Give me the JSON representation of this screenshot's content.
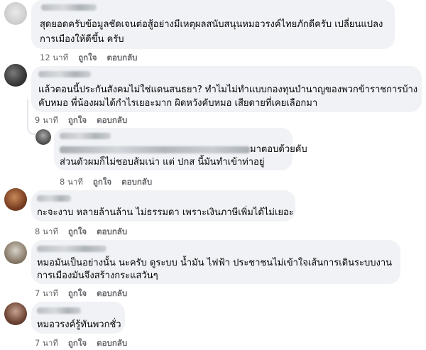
{
  "comments": [
    {
      "text_lines": [
        "สุดยอดครับข้อมูลชัดเจนต่อสู้อย่างมีเหตุผลสนับสนุนหมอวรงค์ไทยภักดีครับ เปลี่ยนแปลง",
        "การเมืองให้ดีขึ้น ครับ"
      ],
      "time": "12 นาที",
      "like": "ถูกใจ",
      "reply": "ตอบกลับ"
    },
    {
      "text_lines": [
        "แล้วตอนนี้ประกันสังคมไม่ใช่แดนสนธยา? ทำไมไม่ทำแบบกองทุนบำนาญของพวกข้าราชการบ้าง",
        "คับหมอ พี่น้องผมได้กำไรเยอะมาก ผิดหวังคับหมอ เสียดายที่เคยเลือกมา"
      ],
      "time": "9 นาที",
      "like": "ถูกใจ",
      "reply": "ตอบกลับ"
    },
    {
      "text_lines": [
        "มาตอบด้วยคับ",
        "ส่วนตัวผมก็ไม่ชอบส้มเน่า แต่ ปกส นี้มันทำเข้าท่าอยู่"
      ],
      "time": "8 นาที",
      "like": "ถูกใจ",
      "reply": "ตอบกลับ"
    },
    {
      "text_lines": [
        "กะจะงาบ หลายล้านล้าน ไม่ธรรมดา เพราะเงินภาษีเพิ่มได้ไม่เยอะ"
      ],
      "time": "8 นาที",
      "like": "ถูกใจ",
      "reply": "ตอบกลับ"
    },
    {
      "text_lines": [
        "หมอมันเป็นอย่างนั้น นะครับ ดูระบบ น้ำมัน ไฟฟ้า ประชาชนไม่เข้าใจเส้นการเดินระบบงาน",
        "การเมืองมันจึงสร้างกระแสวันๆ"
      ],
      "time": "7 นาที",
      "like": "ถูกใจ",
      "reply": "ตอบกลับ"
    },
    {
      "text_lines": [
        "หมอวรงค์รู้ทันพวกชั่ว"
      ],
      "time": "7 นาที",
      "like": "ถูกใจ",
      "reply": "ตอบกลับ"
    }
  ]
}
